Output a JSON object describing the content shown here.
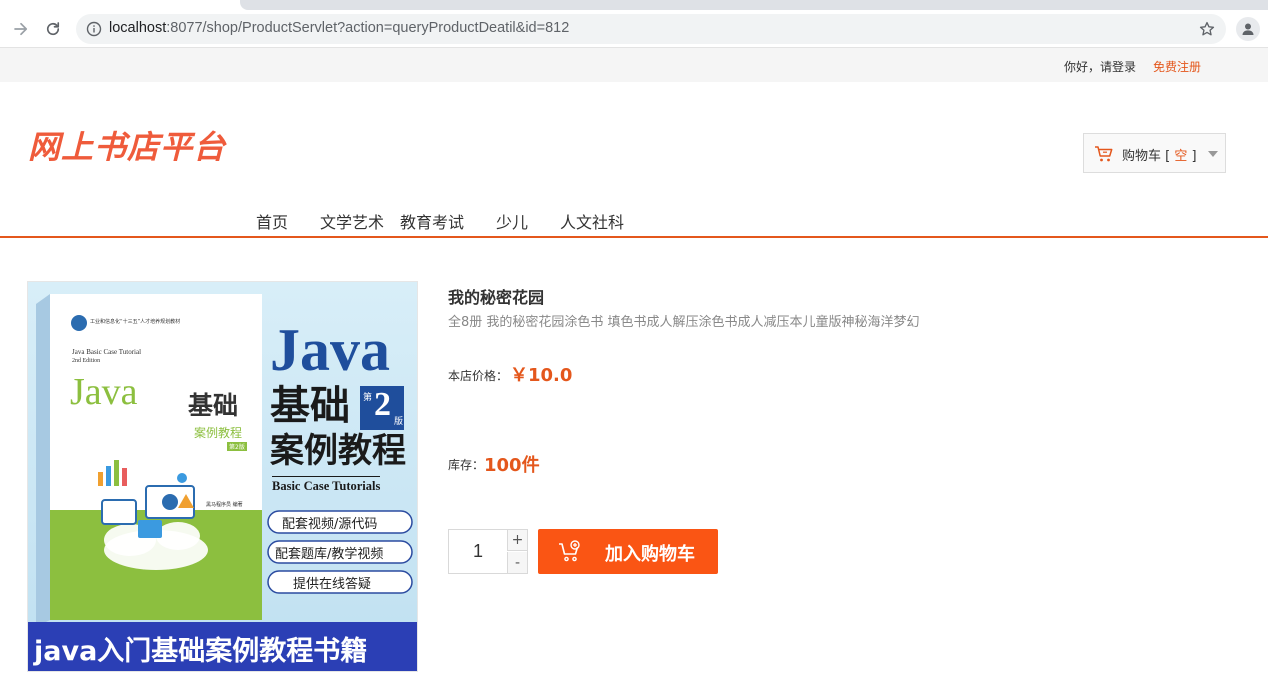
{
  "browser": {
    "url_host": "localhost",
    "url_rest": ":8077/shop/ProductServlet?action=queryProductDeatil&id=812"
  },
  "topbar": {
    "greeting": "你好，请登录",
    "register": "免费注册"
  },
  "header": {
    "logo": "网上书店平台",
    "cart_label": "购物车 [ ",
    "cart_state": "空",
    "cart_suffix": " ]"
  },
  "nav": {
    "items": [
      "首页",
      "文学艺术",
      "教育考试",
      "少儿",
      "人文社科"
    ]
  },
  "product": {
    "title": "我的秘密花园",
    "description": "全8册 我的秘密花园涂色书 填色书成人解压涂色书成人减压本儿童版神秘海洋梦幻",
    "price_label": "本店价格：",
    "price": "￥10.0",
    "stock_label": "库存：",
    "stock": "100件",
    "quantity": "1",
    "plus": "+",
    "minus": "-",
    "add_to_cart": "加入购物车",
    "image": {
      "badge": "工业和信息化“十三五”人才培养规划教材",
      "en_title": "Java Basic Case Tutorial",
      "edition_en": "2nd Edition",
      "java": "Java",
      "jichu": "基础",
      "case_tutorial": "案例教程",
      "edition_small": "第2版",
      "big_java": "Java",
      "big_jichu": "基础",
      "big_edition_num": "2",
      "big_edition_a": "第",
      "big_edition_b": "版",
      "big_case": "案例教程",
      "big_en": "Basic Case Tutorials",
      "feature1": "配套视频/源代码",
      "feature2": "配套题库/教学视频",
      "feature3": "提供在线答疑",
      "banner": "java入门基础案例教程书籍",
      "publisher": "黑马程序员 编著",
      "colors": {
        "blue": "#1f4e9c",
        "green": "#8cbf3f",
        "sky": "#cde8f5",
        "banner": "#2b3fb5"
      }
    }
  },
  "colors": {
    "accent": "#e4571c",
    "button": "#fa5514"
  }
}
